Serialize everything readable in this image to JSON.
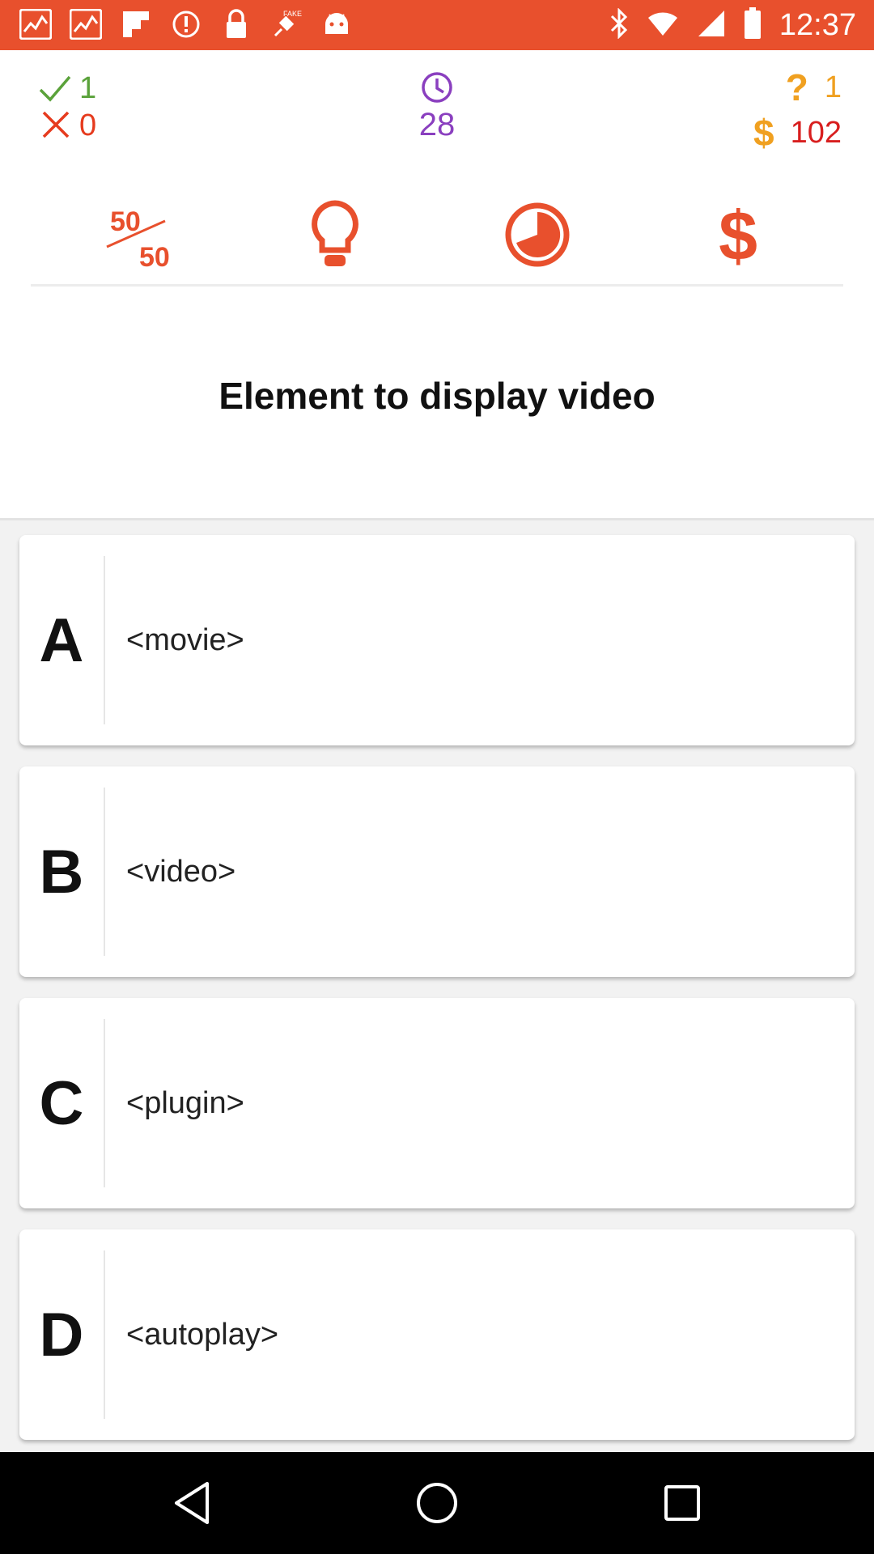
{
  "status_bar": {
    "time": "12:37",
    "left_icons": [
      "iifl-markets-icon",
      "iifl-markets-icon",
      "flipboard-icon",
      "info-icon",
      "lock-icon",
      "fake-gps-icon",
      "android-icon"
    ],
    "right_icons": [
      "bluetooth-icon",
      "wifi-icon",
      "signal-icon",
      "battery-icon"
    ]
  },
  "scores": {
    "correct": "1",
    "wrong": "0",
    "timer": "28",
    "questions": "1",
    "money": "102"
  },
  "lifelines": {
    "fifty_top": "50",
    "fifty_bottom": "50"
  },
  "question": {
    "text": "Element to display video"
  },
  "answers": [
    {
      "letter": "A",
      "text": "<movie>"
    },
    {
      "letter": "B",
      "text": "<video>"
    },
    {
      "letter": "C",
      "text": "<plugin>"
    },
    {
      "letter": "D",
      "text": "<autoplay>"
    }
  ],
  "colors": {
    "status_bar": "#e8502d",
    "accent_orange": "#e8502d",
    "correct_green": "#5aa23a",
    "wrong_red": "#e63b1e",
    "timer_purple": "#8a3fbf",
    "question_yellow": "#f0a020",
    "money_red": "#d81e1e"
  }
}
